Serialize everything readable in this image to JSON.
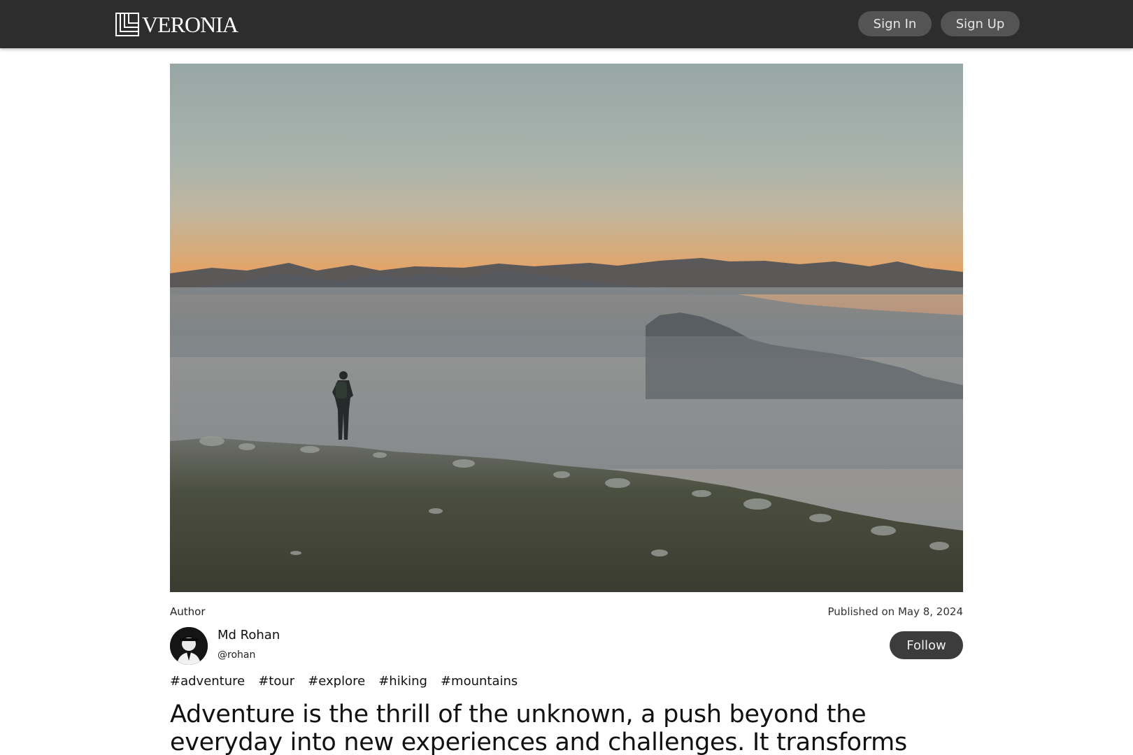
{
  "header": {
    "logo_text": "VERONIA",
    "sign_in_label": "Sign In",
    "sign_up_label": "Sign Up"
  },
  "post": {
    "author_label": "Author",
    "published": "Published on May 8, 2024",
    "author_name": "Md Rohan",
    "author_handle": "@rohan",
    "follow_label": "Follow",
    "tags": [
      "#adventure",
      "#tour",
      "#explore",
      "#hiking",
      "#mountains"
    ],
    "headline": "Adventure is the thrill of the unknown, a push beyond the everyday into new experiences and challenges. It transforms routine into"
  },
  "colors": {
    "header_bg": "#2d2d2d",
    "button_bg": "#545454",
    "follow_bg": "#3c3c3c"
  }
}
